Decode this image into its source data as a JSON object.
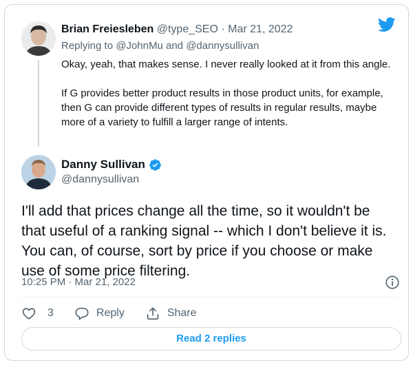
{
  "reply": {
    "author_name": "Brian Freiesleben",
    "author_handle": "@type_SEO",
    "separator": "·",
    "date": "Mar 21, 2022",
    "replying_prefix": "Replying to",
    "mention_1": "@JohnMu",
    "and_word": "and",
    "mention_2": "@dannysullivan",
    "paragraph_1": "Okay, yeah, that makes sense. I never really looked at it from this angle.",
    "paragraph_2": "If G provides better product results in those product units, for example, then G can provide different types of results in regular results, maybe more of a variety to fulfill a larger range of intents."
  },
  "main": {
    "author_name": "Danny Sullivan",
    "author_handle": "@dannysullivan",
    "verified": true,
    "text": "I'll add that prices change all the time, so it wouldn't be that useful of a ranking signal -- which I don't believe it is. You can, of course, sort by price if you choose or make use of some price filtering.",
    "timestamp": "10:25 PM · Mar 21, 2022"
  },
  "actions": {
    "like_count": "3",
    "reply_label": "Reply",
    "share_label": "Share"
  },
  "read_replies_label": "Read 2 replies",
  "colors": {
    "accent": "#1d9bf0",
    "text": "#0f1419",
    "muted": "#536471",
    "border": "#cfd9de"
  },
  "icons": [
    "twitter-bird-icon",
    "verified-badge-icon",
    "info-icon",
    "heart-icon",
    "reply-bubble-icon",
    "share-icon"
  ]
}
